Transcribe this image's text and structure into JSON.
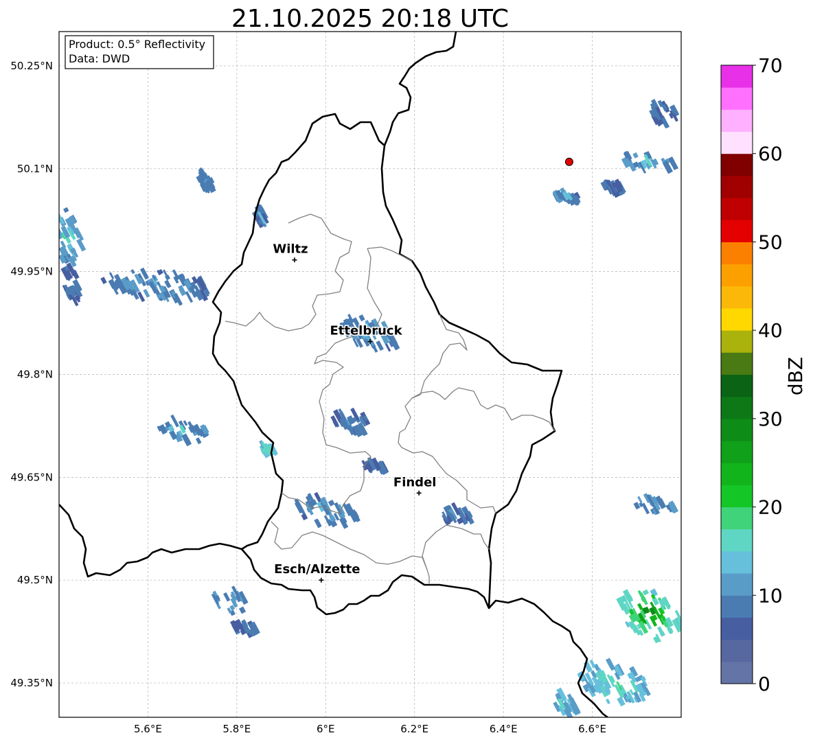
{
  "title": "21.10.2025 20:18 UTC",
  "info_box": {
    "product": "Product: 0.5° Reflectivity",
    "data": "Data: DWD"
  },
  "map": {
    "lon_range": [
      5.4,
      6.8
    ],
    "lat_range": [
      49.3,
      50.3
    ],
    "lat_ticks": [
      {
        "value": 50.25,
        "label": "50.25°N"
      },
      {
        "value": 50.1,
        "label": "50.1°N"
      },
      {
        "value": 49.95,
        "label": "49.95°N"
      },
      {
        "value": 49.8,
        "label": "49.8°N"
      },
      {
        "value": 49.65,
        "label": "49.65°N"
      },
      {
        "value": 49.5,
        "label": "49.5°N"
      },
      {
        "value": 49.35,
        "label": "49.35°N"
      }
    ],
    "lon_ticks": [
      {
        "value": 5.6,
        "label": "5.6°E"
      },
      {
        "value": 5.8,
        "label": "5.8°E"
      },
      {
        "value": 6.0,
        "label": "6°E"
      },
      {
        "value": 6.2,
        "label": "6.2°E"
      },
      {
        "value": 6.4,
        "label": "6.4°E"
      },
      {
        "value": 6.6,
        "label": "6.6°E"
      }
    ],
    "gridlines": true,
    "cities": [
      {
        "name": "Wiltz",
        "lon": 5.93,
        "lat": 49.967
      },
      {
        "name": "Ettelbruck",
        "lon": 6.1,
        "lat": 49.848
      },
      {
        "name": "Findel",
        "lon": 6.21,
        "lat": 49.627
      },
      {
        "name": "Esch/Alzette",
        "lon": 5.99,
        "lat": 49.5
      }
    ],
    "radar_site": {
      "lon": 6.548,
      "lat": 50.11,
      "color": "#e00000"
    }
  },
  "colorbar": {
    "label": "dBZ",
    "min": 0,
    "max": 70,
    "step": 2.5,
    "ticks": [
      {
        "value": 0,
        "label": "0"
      },
      {
        "value": 10,
        "label": "10"
      },
      {
        "value": 20,
        "label": "20"
      },
      {
        "value": 30,
        "label": "30"
      },
      {
        "value": 40,
        "label": "40"
      },
      {
        "value": 50,
        "label": "50"
      },
      {
        "value": 60,
        "label": "60"
      },
      {
        "value": 70,
        "label": "70"
      }
    ],
    "colors": [
      "#6474a6",
      "#5767a0",
      "#475ea0",
      "#4a7cb2",
      "#5a9cc8",
      "#66c0dc",
      "#5fd6c4",
      "#40d47a",
      "#14c626",
      "#12b41c",
      "#10a01a",
      "#0e8c18",
      "#0c7816",
      "#0a6414",
      "#4a7a14",
      "#aab20c",
      "#ffd800",
      "#fcb808",
      "#fca000",
      "#fc8000",
      "#e40000",
      "#c00000",
      "#a00000",
      "#800000",
      "#ffe0ff",
      "#ffb0ff",
      "#ff70ff",
      "#e830e8"
    ]
  },
  "echo_cells": [
    {
      "lon": 5.42,
      "lat": 50.0,
      "lat_h": 0.08,
      "lon_w": 0.06,
      "dbz": 9,
      "peak": 21
    },
    {
      "lon": 5.43,
      "lat": 49.93,
      "lat_h": 0.05,
      "lon_w": 0.04,
      "dbz": 6,
      "peak": 12
    },
    {
      "lon": 5.62,
      "lat": 49.93,
      "lat_h": 0.04,
      "lon_w": 0.24,
      "dbz": 7,
      "peak": 20
    },
    {
      "lon": 5.73,
      "lat": 50.082,
      "lat_h": 0.03,
      "lon_w": 0.03,
      "dbz": 7,
      "peak": 14
    },
    {
      "lon": 5.68,
      "lat": 49.717,
      "lat_h": 0.03,
      "lon_w": 0.11,
      "dbz": 8,
      "peak": 17
    },
    {
      "lon": 5.78,
      "lat": 49.47,
      "lat_h": 0.035,
      "lon_w": 0.08,
      "dbz": 8,
      "peak": 19
    },
    {
      "lon": 5.82,
      "lat": 49.43,
      "lat_h": 0.015,
      "lon_w": 0.06,
      "dbz": 6,
      "peak": 10
    },
    {
      "lon": 5.87,
      "lat": 49.69,
      "lat_h": 0.01,
      "lon_w": 0.03,
      "dbz": 12,
      "peak": 22
    },
    {
      "lon": 5.855,
      "lat": 50.03,
      "lat_h": 0.02,
      "lon_w": 0.02,
      "dbz": 7,
      "peak": 12
    },
    {
      "lon": 6.1,
      "lat": 49.86,
      "lat_h": 0.045,
      "lon_w": 0.14,
      "dbz": 7,
      "peak": 20
    },
    {
      "lon": 6.06,
      "lat": 49.73,
      "lat_h": 0.025,
      "lon_w": 0.09,
      "dbz": 6,
      "peak": 12
    },
    {
      "lon": 6.0,
      "lat": 49.6,
      "lat_h": 0.04,
      "lon_w": 0.14,
      "dbz": 7,
      "peak": 17
    },
    {
      "lon": 6.11,
      "lat": 49.665,
      "lat_h": 0.012,
      "lon_w": 0.05,
      "dbz": 6,
      "peak": 10
    },
    {
      "lon": 6.29,
      "lat": 49.595,
      "lat_h": 0.025,
      "lon_w": 0.08,
      "dbz": 6,
      "peak": 11
    },
    {
      "lon": 6.54,
      "lat": 50.06,
      "lat_h": 0.012,
      "lon_w": 0.06,
      "dbz": 7,
      "peak": 19
    },
    {
      "lon": 6.72,
      "lat": 50.11,
      "lat_h": 0.02,
      "lon_w": 0.14,
      "dbz": 8,
      "peak": 18
    },
    {
      "lon": 6.76,
      "lat": 50.18,
      "lat_h": 0.03,
      "lon_w": 0.06,
      "dbz": 6,
      "peak": 11
    },
    {
      "lon": 6.65,
      "lat": 50.072,
      "lat_h": 0.01,
      "lon_w": 0.05,
      "dbz": 6,
      "peak": 12
    },
    {
      "lon": 6.74,
      "lat": 49.61,
      "lat_h": 0.02,
      "lon_w": 0.09,
      "dbz": 8,
      "peak": 14
    },
    {
      "lon": 6.73,
      "lat": 49.45,
      "lat_h": 0.07,
      "lon_w": 0.14,
      "dbz": 14,
      "peak": 38
    },
    {
      "lon": 6.65,
      "lat": 49.35,
      "lat_h": 0.06,
      "lon_w": 0.15,
      "dbz": 11,
      "peak": 26
    },
    {
      "lon": 6.54,
      "lat": 49.32,
      "lat_h": 0.03,
      "lon_w": 0.05,
      "dbz": 10,
      "peak": 22
    }
  ]
}
